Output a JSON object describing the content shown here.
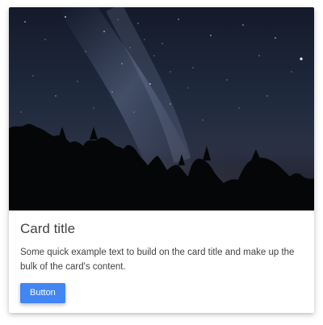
{
  "card": {
    "image_alt": "Night sky with the Milky Way above a silhouetted tree line",
    "title": "Card title",
    "text": "Some quick example text to build on the card title and make up the bulk of the card's content.",
    "button_label": "Button"
  },
  "colors": {
    "button_bg": "#4285f4",
    "button_text": "#ffffff",
    "title_text": "#424242",
    "body_text": "#424242"
  }
}
